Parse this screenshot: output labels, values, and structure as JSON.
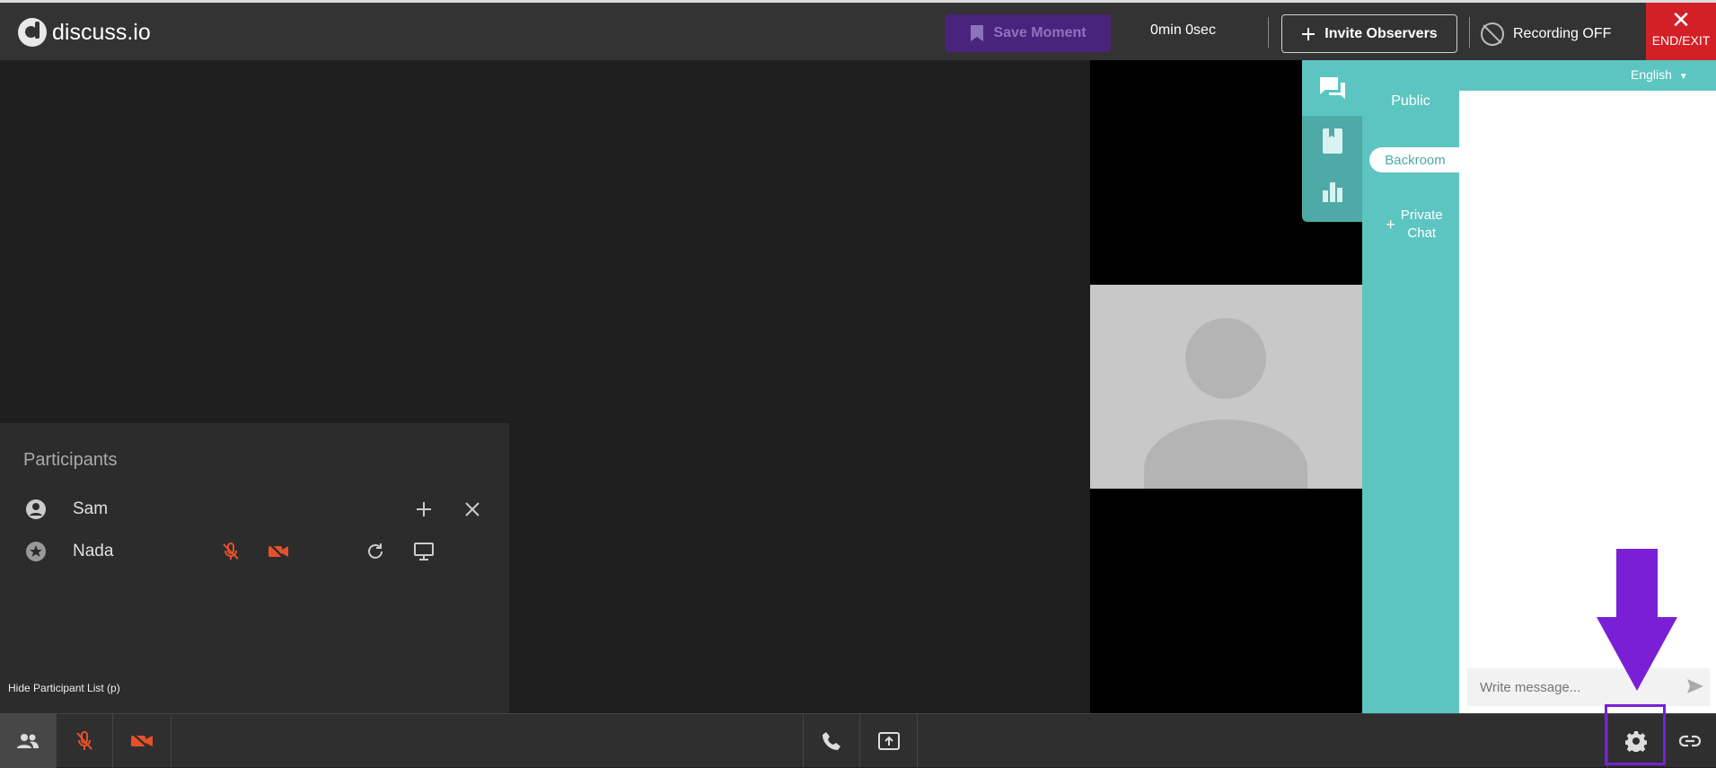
{
  "header": {
    "logo_text": "discuss.io",
    "save_moment_label": "Save Moment",
    "timer": "0min 0sec",
    "invite_label": "Invite Observers",
    "recording_label": "Recording OFF",
    "end_exit_label": "END/EXIT"
  },
  "participants": {
    "title": "Participants",
    "rows": [
      {
        "name": "Sam"
      },
      {
        "name": "Nada"
      }
    ],
    "hide_label": "Hide Participant List (p)"
  },
  "chat": {
    "language": "English",
    "channels": {
      "public": "Public",
      "backroom": "Backroom",
      "private_line1": "Private",
      "private_line2": "Chat"
    },
    "message_placeholder": "Write message..."
  },
  "colors": {
    "accent_teal": "#5cc5c1",
    "alert_orange": "#e8502a",
    "end_red": "#d32027",
    "save_purple": "#4a237c",
    "highlight_purple": "#7b1fd6"
  }
}
